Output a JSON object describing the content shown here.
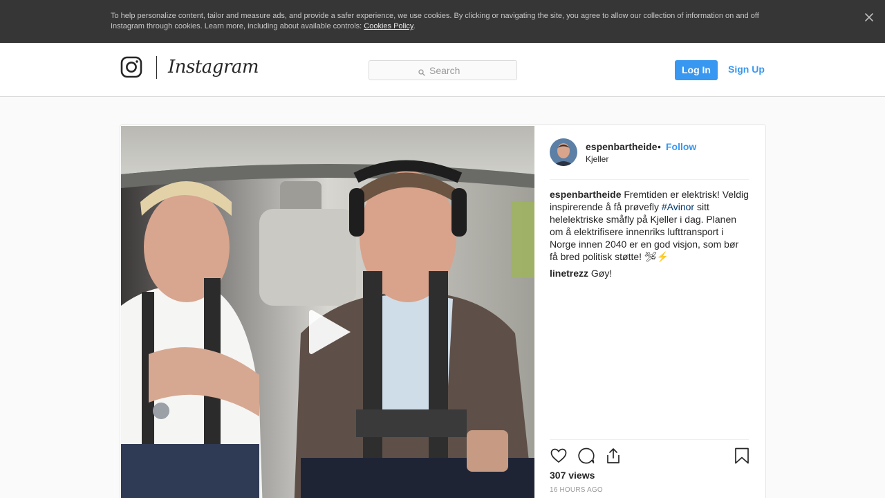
{
  "cookie_banner": {
    "text_before_link": "To help personalize content, tailor and measure ads, and provide a safer experience, we use cookies. By clicking or navigating the site, you agree to allow our collection of information on and off Instagram through cookies. Learn more, including about available controls: ",
    "link_label": "Cookies Policy",
    "text_after_link": ".",
    "close_icon": "close-icon"
  },
  "header": {
    "logo_icon": "instagram-glyph-icon",
    "wordmark": "Instagram",
    "search": {
      "placeholder": "Search",
      "icon": "search-icon"
    },
    "login_label": "Log In",
    "signup_label": "Sign Up"
  },
  "post": {
    "media": {
      "type": "video",
      "play_icon": "play-icon"
    },
    "author": {
      "username": "espenbartheide",
      "separator": "•",
      "follow_label": "Follow",
      "location": "Kjeller"
    },
    "caption": {
      "username": "espenbartheide",
      "text_before_tag": " Fremtiden er elektrisk! Veldig inspirerende å få prøvefly ",
      "hashtag": "#Avinor",
      "text_after_tag": " sitt helelektriske småfly på Kjeller i dag. Planen om å elektrifisere innenriks lufttransport i Norge innen 2040 er en god visjon, som bør få bred politisk støtte! 🛩⚡"
    },
    "comments": [
      {
        "username": "linetrezz",
        "text": " Gøy!"
      }
    ],
    "actions": {
      "like_icon": "heart-icon",
      "comment_icon": "comment-icon",
      "share_icon": "share-icon",
      "save_icon": "bookmark-icon"
    },
    "views": "307 views",
    "timestamp": "16 hours ago"
  }
}
